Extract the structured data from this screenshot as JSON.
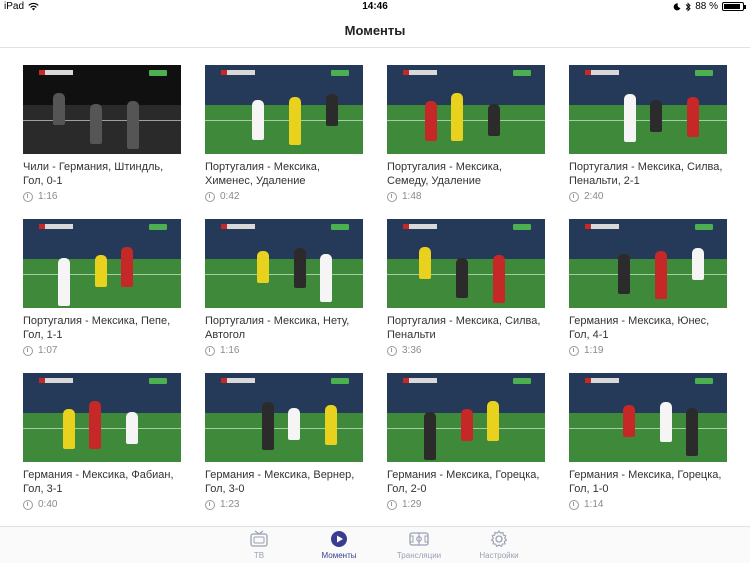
{
  "status_bar": {
    "device": "iPad",
    "time": "14:46",
    "battery_percent": "88 %",
    "battery_level": 0.88
  },
  "nav": {
    "title": "Моменты"
  },
  "moments": [
    {
      "title": "Чили - Германия, Штиндль, Гол, 0-1",
      "duration": "1:16",
      "style": "dark"
    },
    {
      "title": "Португалия - Мексика, Хименес, Удаление",
      "duration": "0:42",
      "style": "field"
    },
    {
      "title": "Португалия - Мексика, Семеду, Удаление",
      "duration": "1:48",
      "style": "field"
    },
    {
      "title": "Португалия - Мексика, Силва, Пенальти, 2-1",
      "duration": "2:40",
      "style": "field"
    },
    {
      "title": "Португалия - Мексика, Пепе, Гол, 1-1",
      "duration": "1:07",
      "style": "field"
    },
    {
      "title": "Португалия - Мексика, Нету, Автогол",
      "duration": "1:16",
      "style": "field"
    },
    {
      "title": "Португалия - Мексика, Силва, Пенальти",
      "duration": "3:36",
      "style": "field"
    },
    {
      "title": "Германия - Мексика, Юнес, Гол, 4-1",
      "duration": "1:19",
      "style": "field"
    },
    {
      "title": "Германия - Мексика, Фабиан, Гол, 3-1",
      "duration": "0:40",
      "style": "field"
    },
    {
      "title": "Германия - Мексика, Вернер, Гол, 3-0",
      "duration": "1:23",
      "style": "field"
    },
    {
      "title": "Германия - Мексика, Горецка, Гол, 2-0",
      "duration": "1:29",
      "style": "field"
    },
    {
      "title": "Германия - Мексика, Горецка, Гол, 1-0",
      "duration": "1:14",
      "style": "field"
    }
  ],
  "tabs": [
    {
      "label": "ТВ",
      "icon": "tv-icon",
      "active": false
    },
    {
      "label": "Моменты",
      "icon": "play-circle-icon",
      "active": true
    },
    {
      "label": "Трансляции",
      "icon": "field-icon",
      "active": false
    },
    {
      "label": "Настройки",
      "icon": "gear-icon",
      "active": false
    }
  ],
  "colors": {
    "accent": "#3a3d8f",
    "inactive": "#9aa1b3"
  }
}
